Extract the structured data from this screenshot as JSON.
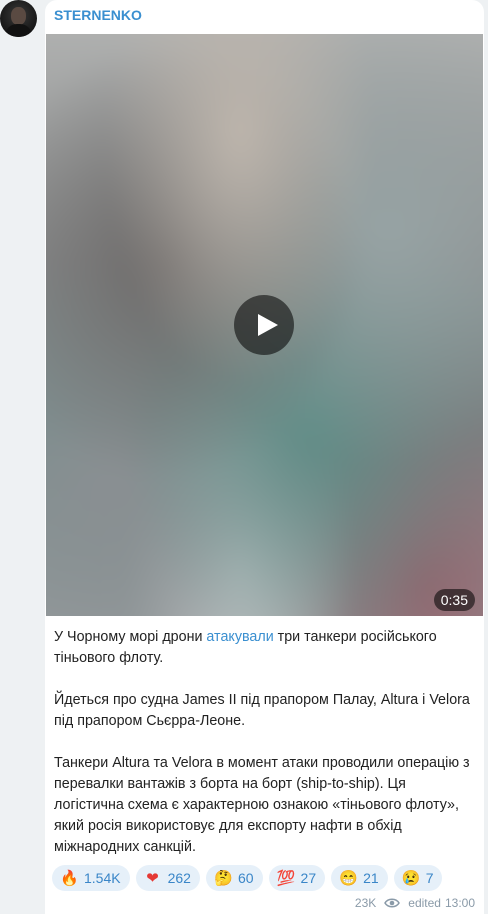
{
  "channel": {
    "name": "STERNENKO"
  },
  "video": {
    "duration": "0:35"
  },
  "post": {
    "p1_before": "У Чорному морі дрони ",
    "p1_link": "атакували",
    "p1_after": " три танкери російського тіньового флоту.",
    "p2": "Йдеться про судна James II під прапором Палау, Altura і Velora під прапором Сьєрра-Леоне.",
    "p3": "Танкери Altura та Velora в момент атаки проводили операцію з перевалки вантажів з борта на борт (ship-to-ship). Ця логістична схема є характерною ознакою «тіньового флоту», який росія використовує для експорту нафти в обхід міжнародних санкцій."
  },
  "reactions": [
    {
      "icon": "fire-icon",
      "glyph": "🔥",
      "count": "1.54K"
    },
    {
      "icon": "heart-icon",
      "glyph": "❤",
      "count": "262"
    },
    {
      "icon": "thinking-face-icon",
      "glyph": "🤔",
      "count": "60"
    },
    {
      "icon": "hundred-points-icon",
      "glyph": "💯",
      "count": "27"
    },
    {
      "icon": "grinning-face-icon",
      "glyph": "😁",
      "count": "21"
    },
    {
      "icon": "crying-face-icon",
      "glyph": "😢",
      "count": "7"
    }
  ],
  "footer": {
    "views": "23K",
    "edited_label": "edited",
    "time": "13:00"
  },
  "colors": {
    "accent": "#3a8fd0",
    "reaction_bg": "#e6f0f9",
    "background": "#eef1f3"
  }
}
